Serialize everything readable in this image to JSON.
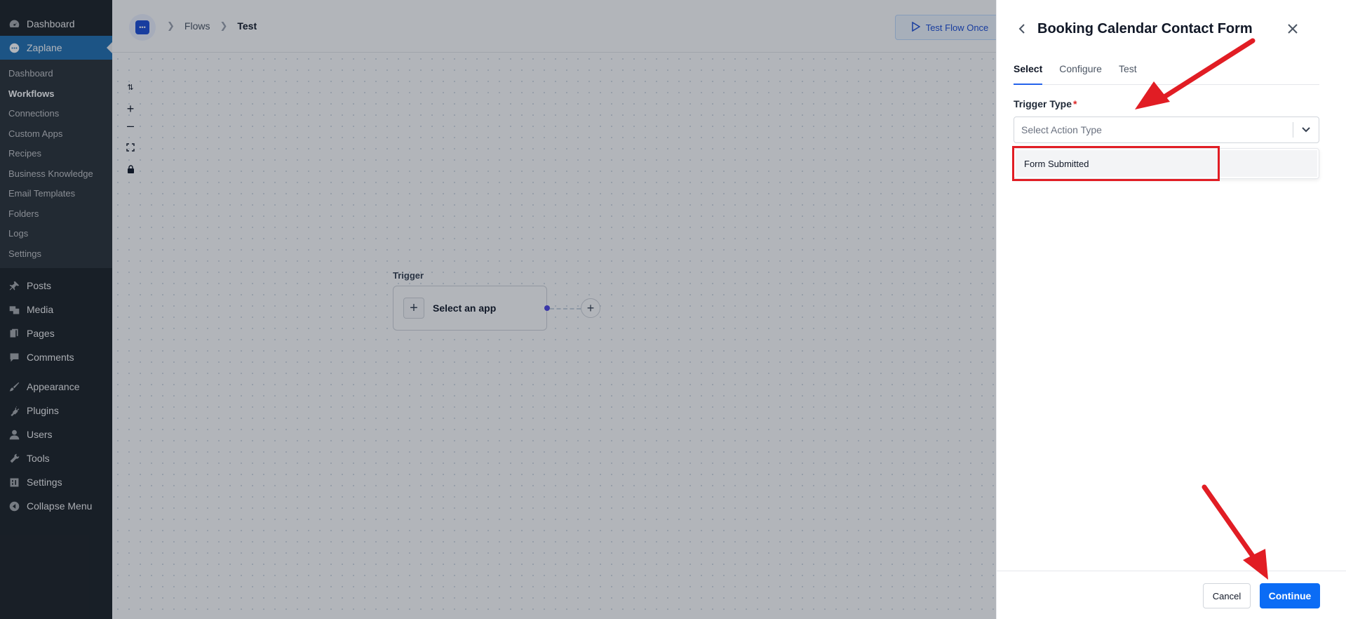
{
  "wp_menu": {
    "top_items": [
      {
        "label": "Dashboard",
        "icon": "dashboard-icon"
      },
      {
        "label": "Zaplane",
        "icon": "zaplane-icon"
      }
    ],
    "zaplane_submenu": [
      "Dashboard",
      "Workflows",
      "Connections",
      "Custom Apps",
      "Recipes",
      "Business Knowledge",
      "Email Templates",
      "Folders",
      "Logs",
      "Settings"
    ],
    "items": [
      {
        "label": "Posts",
        "icon": "pin-icon"
      },
      {
        "label": "Media",
        "icon": "media-icon"
      },
      {
        "label": "Pages",
        "icon": "pages-icon"
      },
      {
        "label": "Comments",
        "icon": "comment-icon"
      },
      {
        "label": "Appearance",
        "icon": "brush-icon"
      },
      {
        "label": "Plugins",
        "icon": "plugin-icon"
      },
      {
        "label": "Users",
        "icon": "user-icon"
      },
      {
        "label": "Tools",
        "icon": "wrench-icon"
      },
      {
        "label": "Settings",
        "icon": "settings-icon"
      },
      {
        "label": "Collapse Menu",
        "icon": "collapse-icon"
      }
    ]
  },
  "header": {
    "breadcrumbs": [
      "Flows",
      "Test"
    ],
    "test_button": "Test Flow Once"
  },
  "canvas": {
    "trigger_label": "Trigger",
    "node_label": "Select an app"
  },
  "panel": {
    "title": "Booking Calendar Contact Form",
    "tabs": [
      "Select",
      "Configure",
      "Test"
    ],
    "field_label": "Trigger Type",
    "required_mark": "*",
    "select_placeholder": "Select Action Type",
    "option": "Form Submitted",
    "cancel": "Cancel",
    "continue": "Continue"
  },
  "colors": {
    "wp_sidebar": "#1d2327",
    "wp_accent": "#2271b1",
    "primary": "#0b6cf5",
    "annotation_red": "#e11d24"
  }
}
